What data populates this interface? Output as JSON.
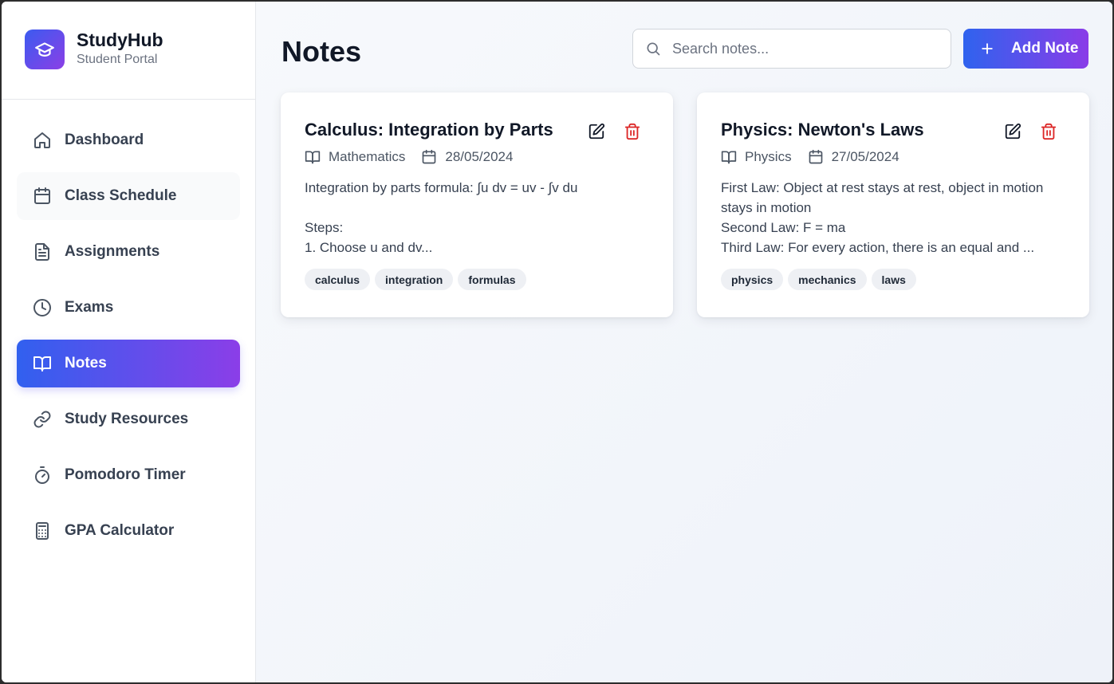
{
  "brand": {
    "title": "StudyHub",
    "subtitle": "Student Portal",
    "icon": "graduation-cap-icon"
  },
  "sidebar": {
    "items": [
      {
        "label": "Dashboard",
        "icon": "home-icon",
        "state": "default"
      },
      {
        "label": "Class Schedule",
        "icon": "calendar-icon",
        "state": "hover"
      },
      {
        "label": "Assignments",
        "icon": "document-icon",
        "state": "default"
      },
      {
        "label": "Exams",
        "icon": "clock-icon",
        "state": "default"
      },
      {
        "label": "Notes",
        "icon": "book-open-icon",
        "state": "active"
      },
      {
        "label": "Study Resources",
        "icon": "link-icon",
        "state": "default"
      },
      {
        "label": "Pomodoro Timer",
        "icon": "timer-icon",
        "state": "default"
      },
      {
        "label": "GPA Calculator",
        "icon": "calculator-icon",
        "state": "default"
      }
    ]
  },
  "header": {
    "title": "Notes",
    "search_placeholder": "Search notes...",
    "add_label": "Add Note"
  },
  "notes": [
    {
      "title": "Calculus: Integration by Parts",
      "subject": "Mathematics",
      "date": "28/05/2024",
      "content": "Integration by parts formula: ∫u dv = uv - ∫v du\n\nSteps:\n1. Choose u and dv...",
      "tags": [
        "calculus",
        "integration",
        "formulas"
      ]
    },
    {
      "title": "Physics: Newton's Laws",
      "subject": "Physics",
      "date": "27/05/2024",
      "content": "First Law: Object at rest stays at rest, object in motion stays in motion\nSecond Law: F = ma\nThird Law: For every action, there is an equal and ...",
      "tags": [
        "physics",
        "mechanics",
        "laws"
      ]
    }
  ],
  "colors": {
    "accent_start": "#3160ef",
    "accent_end": "#8b3ee8",
    "delete": "#dc2626"
  }
}
